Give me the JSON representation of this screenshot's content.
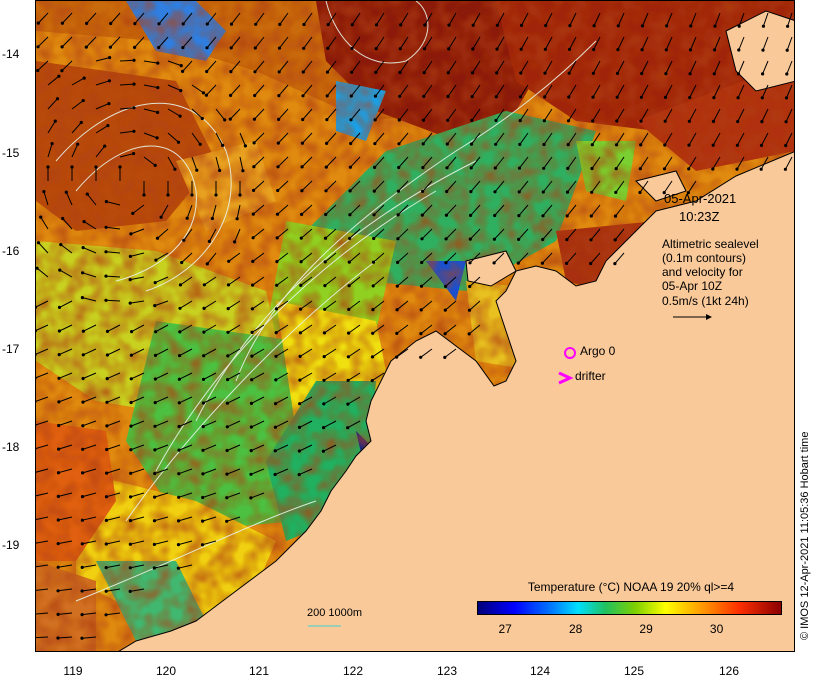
{
  "map": {
    "y_axis_labels": [
      "-14",
      "-15",
      "-16",
      "-17",
      "-18",
      "-19"
    ],
    "x_axis_labels": [
      "119",
      "120",
      "121",
      "122",
      "123",
      "124",
      "125",
      "126"
    ],
    "lat_range": [
      -20.05,
      -13.65
    ],
    "lon_range": [
      118.65,
      126.7
    ],
    "colors": {
      "land": "#f9c99a",
      "ocean_border": "#000000",
      "vectors": "#000000",
      "contours": "#e8f4e8",
      "markers": "#ff00ff"
    }
  },
  "overlay": {
    "date": "05-Apr-2021",
    "time": "10:23Z",
    "desc_line1": "Altimetric sealevel",
    "desc_line2": "(0.1m contours)",
    "desc_line3": "and velocity for",
    "desc_line4": "05-Apr 10Z",
    "speed_scale": "0.5m/s (1kt 24h)"
  },
  "legend": {
    "argo_label": "Argo 0",
    "drifter_label": "drifter",
    "drifter_symbol": ">",
    "depth_scale": "200  1000m"
  },
  "colorbar": {
    "title": "Temperature (°C) NOAA 19 20% ql>=4",
    "ticks": [
      "27",
      "28",
      "29",
      "30"
    ],
    "tick_values": [
      27,
      28,
      29,
      30
    ],
    "range": [
      26.6,
      30.9
    ]
  },
  "credit": "© IMOS 12-Apr-2021 11:05:36 Hobart time"
}
